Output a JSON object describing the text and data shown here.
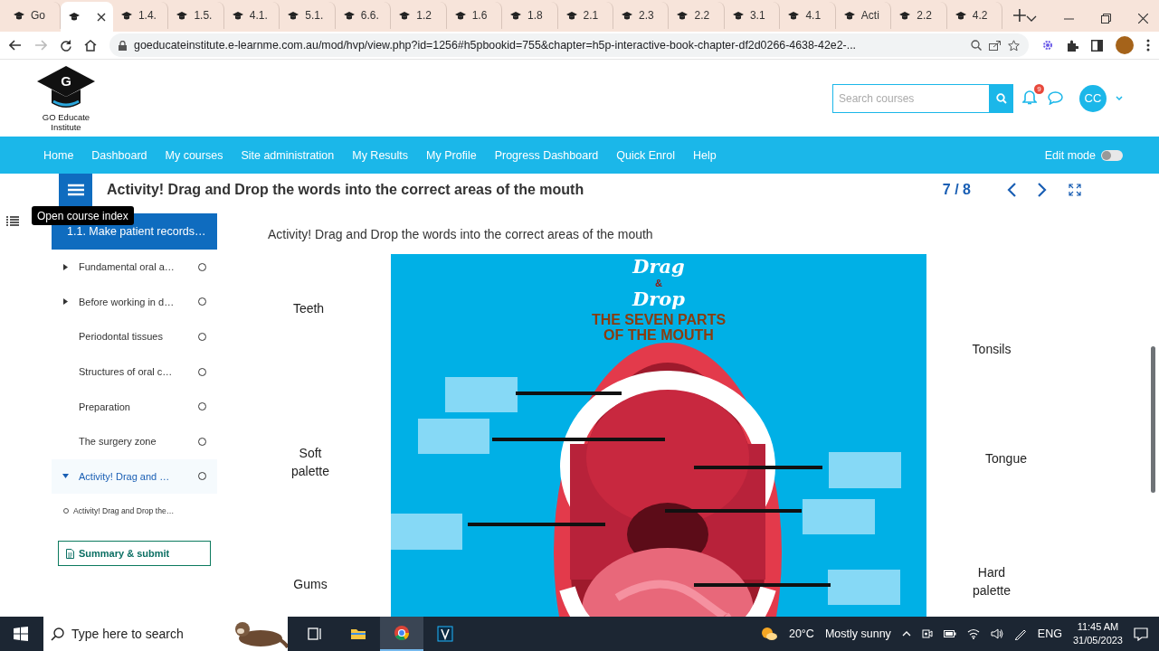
{
  "browser": {
    "tabs": [
      {
        "label": "Go",
        "selected": false
      },
      {
        "selected": true
      },
      {
        "label": "1.4.",
        "selected": false
      },
      {
        "label": "1.5.",
        "selected": false
      },
      {
        "label": "4.1.",
        "selected": false
      },
      {
        "label": "5.1.",
        "selected": false
      },
      {
        "label": "6.6.",
        "selected": false
      },
      {
        "label": "1.2",
        "selected": false
      },
      {
        "label": "1.6",
        "selected": false
      },
      {
        "label": "1.8",
        "selected": false
      },
      {
        "label": "2.1",
        "selected": false
      },
      {
        "label": "2.3",
        "selected": false
      },
      {
        "label": "2.2",
        "selected": false
      },
      {
        "label": "3.1",
        "selected": false
      },
      {
        "label": "4.1",
        "selected": false
      },
      {
        "label": "Acti",
        "selected": false
      },
      {
        "label": "2.2",
        "selected": false
      },
      {
        "label": "4.2",
        "selected": false
      }
    ],
    "address": "goeducateinstitute.e-learnme.com.au/mod/hvp/view.php?id=1256#h5pbookid=755&chapter=h5p-interactive-book-chapter-df2d0266-4638-42e2-..."
  },
  "header": {
    "logo_letter": "G",
    "logo_text": "GO Educate Institute",
    "search": {
      "placeholder": "Search courses"
    },
    "notification_count": "9",
    "avatar": "CC"
  },
  "nav": {
    "items": [
      "Home",
      "Dashboard",
      "My courses",
      "Site administration",
      "My Results",
      "My Profile",
      "Progress Dashboard",
      "Quick Enrol",
      "Help"
    ],
    "edit_mode": {
      "label": "Edit mode",
      "on": false
    }
  },
  "book": {
    "title": "Activity! Drag and Drop the words into the correct areas of the mouth",
    "page": "7 / 8"
  },
  "sidebar": {
    "tooltip": "Open course index",
    "chapter": "1.1. Make patient records…",
    "items": [
      {
        "label": "Fundamental oral a…",
        "kind": "expandable",
        "expanded": false,
        "selected": false
      },
      {
        "label": "Before working in d…",
        "kind": "expandable",
        "expanded": false,
        "selected": false
      },
      {
        "label": "Periodontal tissues",
        "kind": "plain",
        "selected": false
      },
      {
        "label": "Structures of oral c…",
        "kind": "plain",
        "selected": false
      },
      {
        "label": "Preparation",
        "kind": "plain",
        "selected": false
      },
      {
        "label": "The surgery zone",
        "kind": "plain",
        "selected": false
      },
      {
        "label": "Activity! Drag and …",
        "kind": "expandable",
        "expanded": true,
        "selected": true,
        "children": [
          {
            "label": "Activity! Drag and Drop the…"
          }
        ]
      }
    ],
    "summary_button": "Summary & submit"
  },
  "task": {
    "instruction": "Activity! Drag and Drop the words into the correct areas of the mouth",
    "image_title": {
      "line_1": "Drag",
      "ampersand": "&",
      "line_2": "Drop",
      "subtitle_1": "THE SEVEN PARTS",
      "subtitle_2": "OF THE MOUTH"
    },
    "words": [
      {
        "label": "Teeth"
      },
      {
        "label": "Soft palette"
      },
      {
        "label": "Gums"
      },
      {
        "label": "Tonsils"
      },
      {
        "label": "Tongue"
      },
      {
        "label": "Hard palette"
      }
    ]
  },
  "taskbar": {
    "search_placeholder": "Type here to search",
    "temperature": "20°C",
    "weather": "Mostly sunny",
    "language": "ENG",
    "time": "11:45 AM",
    "date": "31/05/2023"
  }
}
